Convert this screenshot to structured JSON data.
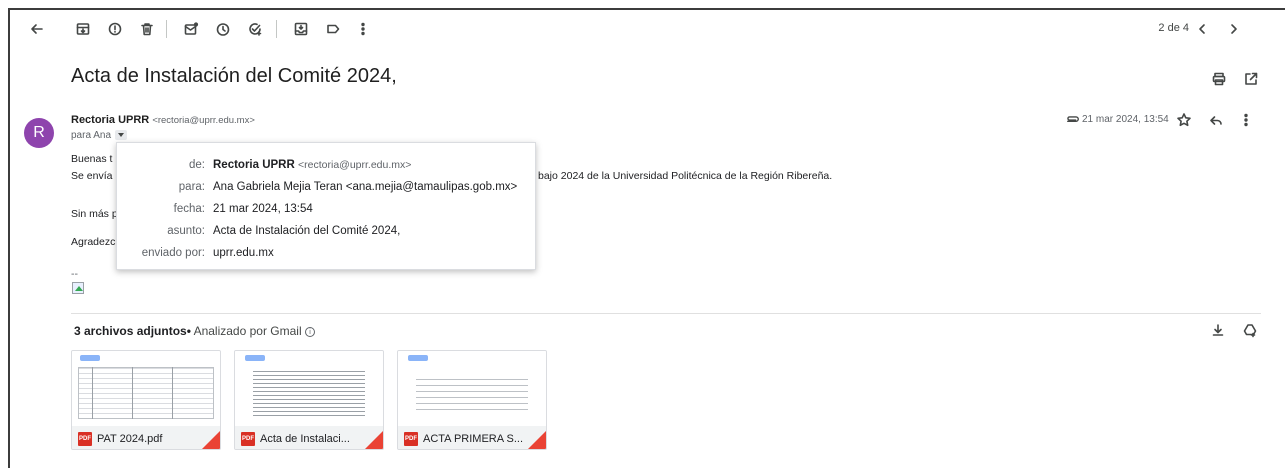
{
  "toolbar": {
    "back_icon": "arrow-left-icon",
    "icons": [
      "archive-icon",
      "report-spam-icon",
      "delete-icon",
      "mark-unread-icon",
      "snooze-icon",
      "add-task-icon",
      "move-to-icon",
      "label-icon",
      "more-vert-icon"
    ],
    "pager_text": "2 de 4"
  },
  "subject": "Acta de Instalación del Comité 2024,",
  "message": {
    "avatar_letter": "R",
    "avatar_color": "#8e44ad",
    "sender_name": "Rectoria UPRR",
    "sender_email": "<rectoria@uprr.edu.mx>",
    "to_text": "para Ana",
    "datetime": "21 mar 2024, 13:54",
    "body": {
      "line1": "Buenas t",
      "line2": "Se envía",
      "line2_tail": "bajo 2024  de la Universidad Politécnica de la Región Ribereña.",
      "line3": "Sin más p",
      "line4": "Agradezc",
      "sig": "--"
    }
  },
  "details_popup": {
    "de_label": "de:",
    "de_name": "Rectoria UPRR",
    "de_email": "<rectoria@uprr.edu.mx>",
    "para_label": "para:",
    "para_value": "Ana Gabriela Mejia Teran <ana.mejia@tamaulipas.gob.mx>",
    "fecha_label": "fecha:",
    "fecha_value": "21 mar 2024, 13:54",
    "asunto_label": "asunto:",
    "asunto_value": "Acta de Instalación del Comité 2024,",
    "enviado_label": "enviado por:",
    "enviado_value": "uprr.edu.mx"
  },
  "attachments": {
    "count_label": "3 archivos adjuntos",
    "scan_label": "Analizado por Gmail",
    "items": [
      {
        "name": "PAT 2024.pdf",
        "badge": "PDF"
      },
      {
        "name": "Acta de Instalaci...",
        "badge": "PDF"
      },
      {
        "name": "ACTA PRIMERA S...",
        "badge": "PDF"
      }
    ]
  },
  "colors": {
    "accent_red": "#ea4335",
    "pdf_red": "#d93025"
  }
}
